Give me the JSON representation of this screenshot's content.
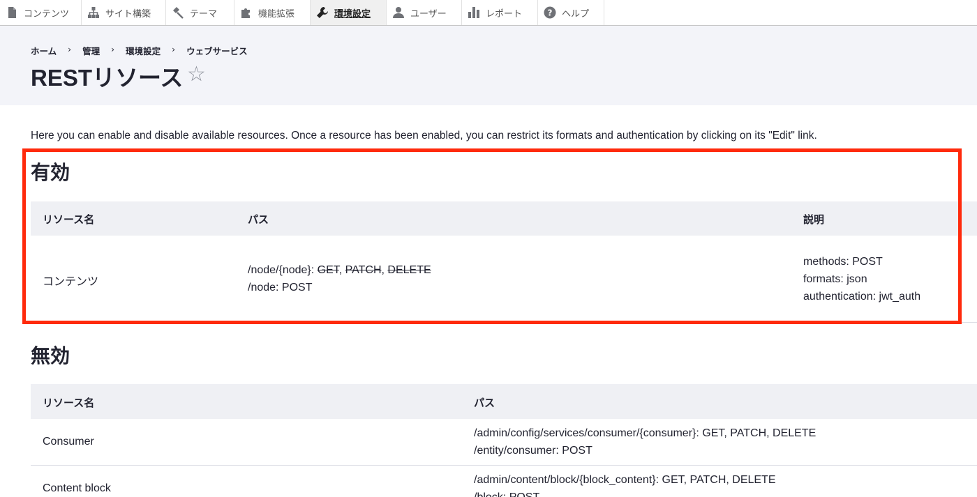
{
  "toolbar": {
    "items": [
      {
        "label": "コンテンツ",
        "icon": "document-icon"
      },
      {
        "label": "サイト構築",
        "icon": "sitemap-icon"
      },
      {
        "label": "テーマ",
        "icon": "paintbrush-icon"
      },
      {
        "label": "機能拡張",
        "icon": "puzzle-icon"
      },
      {
        "label": "環境設定",
        "icon": "wrench-icon",
        "active": true
      },
      {
        "label": "ユーザー",
        "icon": "user-icon"
      },
      {
        "label": "レポート",
        "icon": "bar-chart-icon"
      },
      {
        "label": "ヘルプ",
        "icon": "help-icon"
      }
    ]
  },
  "breadcrumb": [
    "ホーム",
    "管理",
    "環境設定",
    "ウェブサービス"
  ],
  "breadcrumb_separator": "›",
  "page": {
    "title": "RESTリソース",
    "star": "☆",
    "intro": "Here you can enable and disable available resources. Once a resource has been enabled, you can restrict its formats and authentication by clicking on its \"Edit\" link."
  },
  "enabled": {
    "title": "有効",
    "headers": {
      "name": "リソース名",
      "path": "パス",
      "description": "説明"
    },
    "row": {
      "name": "コンテンツ",
      "path_line1_prefix": "/node/{node}: ",
      "path_line1_methods": [
        "GET",
        "PATCH",
        "DELETE"
      ],
      "path_line1_separator": ", ",
      "path_line2": "/node: POST",
      "desc_line1": "methods: POST",
      "desc_line2": "formats: json",
      "desc_line3": "authentication: jwt_auth"
    }
  },
  "disabled": {
    "title": "無効",
    "headers": {
      "name": "リソース名",
      "path": "パス"
    },
    "rows": [
      {
        "name": "Consumer",
        "path_line1": "/admin/config/services/consumer/{consumer}: GET, PATCH, DELETE",
        "path_line2": "/entity/consumer: POST"
      },
      {
        "name": "Content block",
        "path_line1": "/admin/content/block/{block_content}: GET, PATCH, DELETE",
        "path_line2": "/block: POST"
      }
    ]
  },
  "colors": {
    "annotation": "#ff2a0c",
    "header_bg": "#f3f4f9",
    "table_head_bg": "#eff0f4"
  }
}
